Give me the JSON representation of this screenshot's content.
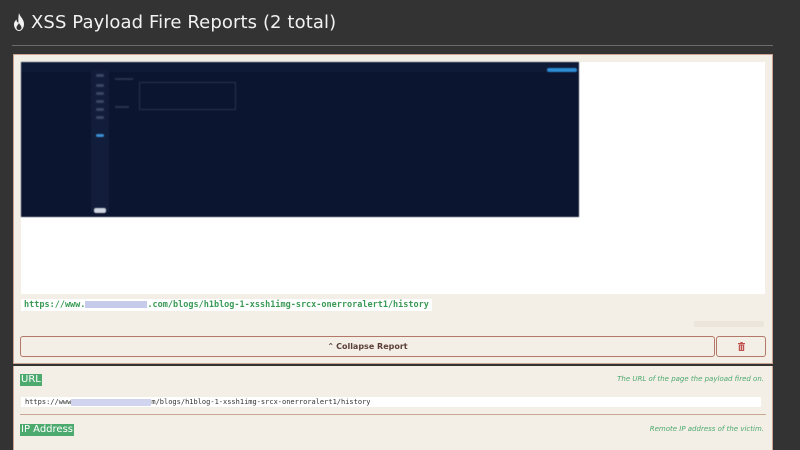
{
  "header": {
    "title": "XSS Payload Fire Reports (2 total)",
    "icon": "flame-icon"
  },
  "report": {
    "url_prefix": "https://www.",
    "url_suffix": ".com/blogs/h1blog-1-xssh1img-srcx-onerroralert1/history",
    "collapse_label": "Collapse Report",
    "collapse_icon": "double-chevron-up-icon",
    "delete_icon": "trash-icon"
  },
  "fields": [
    {
      "label": "URL",
      "description": "The URL of the page the payload fired on.",
      "value_prefix": "https://www",
      "value_suffix": "m/blogs/h1blog-1-xssh1img-srcx-onerroralert1/history"
    },
    {
      "label": "IP Address",
      "description": "Remote IP address of the victim."
    }
  ],
  "colors": {
    "page_bg": "#333333",
    "panel_bg": "#f3eee6",
    "accent_green": "#4caa6e",
    "button_border": "#b4786a",
    "delete_red": "#c0504d"
  }
}
